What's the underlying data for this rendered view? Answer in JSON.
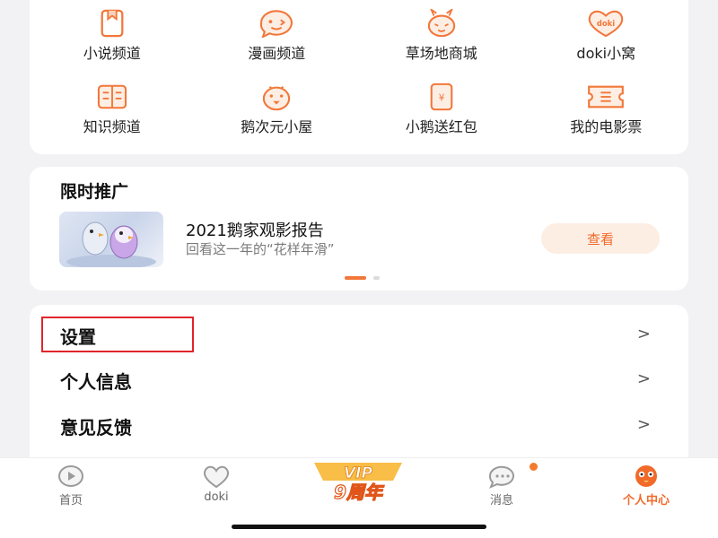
{
  "grid": {
    "items": [
      {
        "label": "小说频道",
        "icon": "book-icon"
      },
      {
        "label": "漫画频道",
        "icon": "comic-face-icon"
      },
      {
        "label": "草场地商城",
        "icon": "rabbit-shop-icon"
      },
      {
        "label": "doki小窝",
        "icon": "doki-heart-icon"
      },
      {
        "label": "知识频道",
        "icon": "open-book-icon"
      },
      {
        "label": "鹅次元小屋",
        "icon": "penguin-face-icon"
      },
      {
        "label": "小鹅送红包",
        "icon": "red-envelope-icon"
      },
      {
        "label": "我的电影票",
        "icon": "movie-ticket-icon"
      }
    ],
    "doki_badge": "doki"
  },
  "promo": {
    "title": "限时推广",
    "headline": "2021鹅家观影报告",
    "subtitle": "回看这一年的“花样年滑”",
    "button": "查看"
  },
  "menu": {
    "items": [
      {
        "label": "设置"
      },
      {
        "label": "个人信息"
      },
      {
        "label": "意见反馈"
      }
    ],
    "chevron": ">"
  },
  "tabbar": {
    "tabs": [
      {
        "label": "首页",
        "icon": "home-play-icon"
      },
      {
        "label": "doki",
        "icon": "doki-heart-icon"
      },
      {
        "label": "消息",
        "icon": "message-bubble-icon"
      },
      {
        "label": "个人中心",
        "icon": "profile-face-icon",
        "active": true
      }
    ],
    "vip_top": "VIP",
    "vip_bottom": "9周年"
  },
  "colors": {
    "accent": "#f16a2a",
    "icon_orange": "#f2773a",
    "highlight_red": "#e0242b"
  }
}
